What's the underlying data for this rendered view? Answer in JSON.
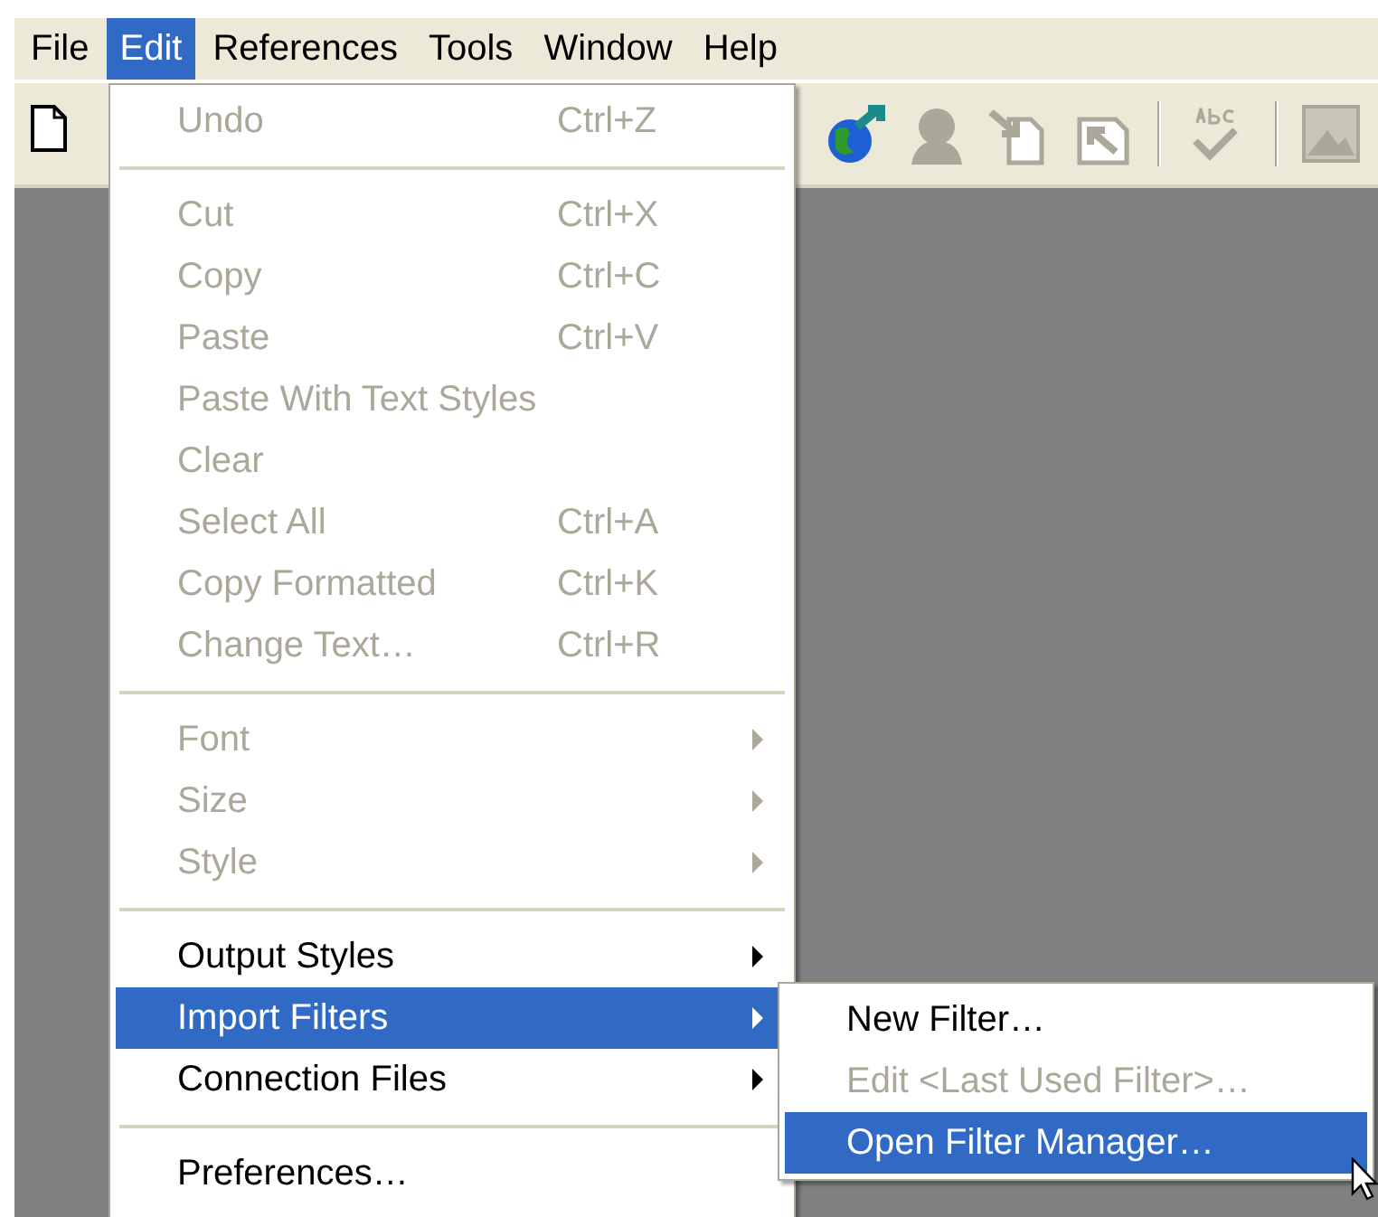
{
  "menubar": [
    {
      "label": "File",
      "selected": false
    },
    {
      "label": "Edit",
      "selected": true
    },
    {
      "label": "References",
      "selected": false
    },
    {
      "label": "Tools",
      "selected": false
    },
    {
      "label": "Window",
      "selected": false
    },
    {
      "label": "Help",
      "selected": false
    }
  ],
  "edit_menu": {
    "items": [
      {
        "kind": "item",
        "label": "Undo",
        "shortcut": "Ctrl+Z",
        "disabled": true,
        "selected": false,
        "has_submenu": false
      },
      {
        "kind": "separator"
      },
      {
        "kind": "item",
        "label": "Cut",
        "shortcut": "Ctrl+X",
        "disabled": true,
        "selected": false,
        "has_submenu": false
      },
      {
        "kind": "item",
        "label": "Copy",
        "shortcut": "Ctrl+C",
        "disabled": true,
        "selected": false,
        "has_submenu": false
      },
      {
        "kind": "item",
        "label": "Paste",
        "shortcut": "Ctrl+V",
        "disabled": true,
        "selected": false,
        "has_submenu": false
      },
      {
        "kind": "item",
        "label": "Paste With Text Styles",
        "disabled": true,
        "selected": false,
        "has_submenu": false
      },
      {
        "kind": "item",
        "label": "Clear",
        "disabled": true,
        "selected": false,
        "has_submenu": false
      },
      {
        "kind": "item",
        "label": "Select All",
        "shortcut": "Ctrl+A",
        "disabled": true,
        "selected": false,
        "has_submenu": false
      },
      {
        "kind": "item",
        "label": "Copy Formatted",
        "shortcut": "Ctrl+K",
        "disabled": true,
        "selected": false,
        "has_submenu": false
      },
      {
        "kind": "item",
        "label": "Change Text…",
        "shortcut": "Ctrl+R",
        "disabled": true,
        "selected": false,
        "has_submenu": false
      },
      {
        "kind": "separator"
      },
      {
        "kind": "item",
        "label": "Font",
        "disabled": true,
        "selected": false,
        "has_submenu": true
      },
      {
        "kind": "item",
        "label": "Size",
        "disabled": true,
        "selected": false,
        "has_submenu": true
      },
      {
        "kind": "item",
        "label": "Style",
        "disabled": true,
        "selected": false,
        "has_submenu": true
      },
      {
        "kind": "separator"
      },
      {
        "kind": "item",
        "label": "Output Styles",
        "disabled": false,
        "selected": false,
        "has_submenu": true
      },
      {
        "kind": "item",
        "label": "Import Filters",
        "disabled": false,
        "selected": true,
        "has_submenu": true
      },
      {
        "kind": "item",
        "label": "Connection Files",
        "disabled": false,
        "selected": false,
        "has_submenu": true
      },
      {
        "kind": "separator"
      },
      {
        "kind": "item",
        "label": "Preferences…",
        "disabled": false,
        "selected": false,
        "has_submenu": false
      }
    ]
  },
  "import_filters_submenu": {
    "items": [
      {
        "kind": "item",
        "label": "New Filter…",
        "disabled": false,
        "selected": false,
        "has_submenu": false
      },
      {
        "kind": "item",
        "label": "Edit <Last Used Filter>…",
        "disabled": true,
        "selected": false,
        "has_submenu": false
      },
      {
        "kind": "item",
        "label": "Open Filter Manager…",
        "disabled": false,
        "selected": true,
        "has_submenu": false
      }
    ]
  }
}
